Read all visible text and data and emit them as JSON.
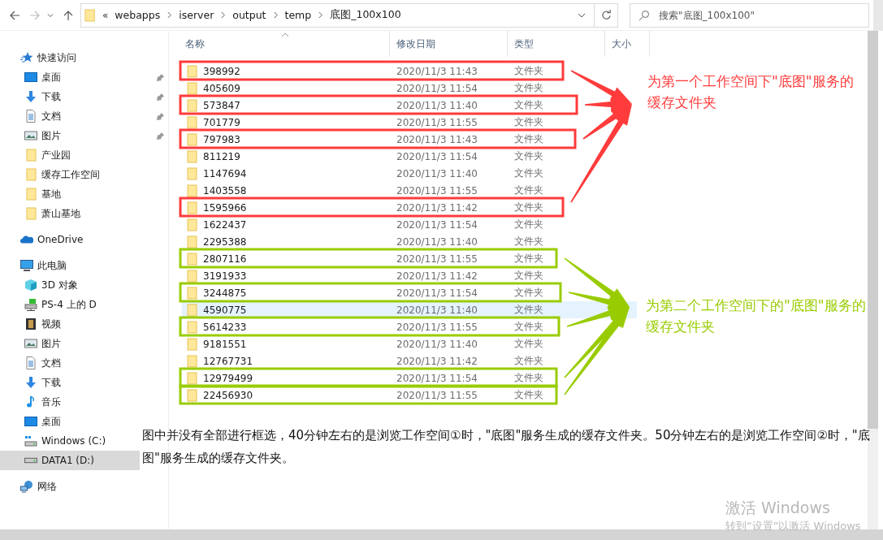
{
  "address_bar": {
    "overflow": "«",
    "segments": [
      "webapps",
      "iserver",
      "output",
      "temp",
      "底图_100x100"
    ]
  },
  "search": {
    "placeholder": "搜索\"底图_100x100\""
  },
  "sidebar": {
    "items": [
      {
        "label": "快速访问",
        "kind": "star",
        "selected": false,
        "children": [
          {
            "label": "桌面",
            "kind": "desktop",
            "pinned": true,
            "selected": false
          },
          {
            "label": "下载",
            "kind": "download",
            "pinned": true,
            "selected": false
          },
          {
            "label": "文档",
            "kind": "document",
            "pinned": true,
            "selected": false
          },
          {
            "label": "图片",
            "kind": "picture",
            "pinned": true,
            "selected": false
          },
          {
            "label": "产业园",
            "kind": "folder",
            "pinned": false,
            "selected": false
          },
          {
            "label": "缓存工作空间",
            "kind": "folder",
            "pinned": false,
            "selected": false
          },
          {
            "label": "基地",
            "kind": "folder",
            "pinned": false,
            "selected": false
          },
          {
            "label": "萧山基地",
            "kind": "folder",
            "pinned": false,
            "selected": false
          }
        ]
      },
      {
        "label": "OneDrive",
        "kind": "cloud",
        "selected": false
      },
      {
        "label": "此电脑",
        "kind": "computer",
        "selected": false,
        "children": [
          {
            "label": "3D 对象",
            "kind": "cube",
            "selected": false
          },
          {
            "label": "PS-4 上的 D",
            "kind": "netdrive",
            "selected": false
          },
          {
            "label": "视频",
            "kind": "video",
            "selected": false
          },
          {
            "label": "图片",
            "kind": "picture",
            "selected": false
          },
          {
            "label": "文档",
            "kind": "document",
            "selected": false
          },
          {
            "label": "下载",
            "kind": "download",
            "selected": false
          },
          {
            "label": "音乐",
            "kind": "music",
            "selected": false
          },
          {
            "label": "桌面",
            "kind": "desktop",
            "selected": false
          },
          {
            "label": "Windows (C:)",
            "kind": "windrive",
            "selected": false
          },
          {
            "label": "DATA1 (D:)",
            "kind": "drive",
            "selected": true
          }
        ]
      },
      {
        "label": "网络",
        "kind": "network",
        "selected": false
      }
    ]
  },
  "file_list": {
    "columns": [
      "名称",
      "修改日期",
      "类型",
      "大小"
    ],
    "rows": [
      {
        "name": "398992",
        "modified": "2020/11/3 11:43",
        "type": "文件夹",
        "hovered": false,
        "color": "#ff3b3b"
      },
      {
        "name": "405609",
        "modified": "2020/11/3 11:54",
        "type": "文件夹",
        "hovered": false
      },
      {
        "name": "573847",
        "modified": "2020/11/3 11:40",
        "type": "文件夹",
        "hovered": false,
        "color": "#ff3b3b"
      },
      {
        "name": "701779",
        "modified": "2020/11/3 11:55",
        "type": "文件夹",
        "hovered": false
      },
      {
        "name": "797983",
        "modified": "2020/11/3 11:43",
        "type": "文件夹",
        "hovered": false,
        "color": "#ff3b3b"
      },
      {
        "name": "811219",
        "modified": "2020/11/3 11:54",
        "type": "文件夹",
        "hovered": false
      },
      {
        "name": "1147694",
        "modified": "2020/11/3 11:40",
        "type": "文件夹",
        "hovered": false
      },
      {
        "name": "1403558",
        "modified": "2020/11/3 11:55",
        "type": "文件夹",
        "hovered": false
      },
      {
        "name": "1595966",
        "modified": "2020/11/3 11:42",
        "type": "文件夹",
        "hovered": false,
        "color": "#ff3b3b"
      },
      {
        "name": "1622437",
        "modified": "2020/11/3 11:54",
        "type": "文件夹",
        "hovered": false
      },
      {
        "name": "2295388",
        "modified": "2020/11/3 11:40",
        "type": "文件夹",
        "hovered": false
      },
      {
        "name": "2807116",
        "modified": "2020/11/3 11:55",
        "type": "文件夹",
        "hovered": false,
        "color": "#99cc00"
      },
      {
        "name": "3191933",
        "modified": "2020/11/3 11:42",
        "type": "文件夹",
        "hovered": false
      },
      {
        "name": "3244875",
        "modified": "2020/11/3 11:54",
        "type": "文件夹",
        "hovered": false,
        "color": "#99cc00"
      },
      {
        "name": "4590775",
        "modified": "2020/11/3 11:40",
        "type": "文件夹",
        "hovered": true
      },
      {
        "name": "5614233",
        "modified": "2020/11/3 11:55",
        "type": "文件夹",
        "hovered": false,
        "color": "#99cc00"
      },
      {
        "name": "9181551",
        "modified": "2020/11/3 11:40",
        "type": "文件夹",
        "hovered": false
      },
      {
        "name": "12767731",
        "modified": "2020/11/3 11:42",
        "type": "文件夹",
        "hovered": false
      },
      {
        "name": "12979499",
        "modified": "2020/11/3 11:54",
        "type": "文件夹",
        "hovered": false,
        "color": "#99cc00"
      },
      {
        "name": "22456930",
        "modified": "2020/11/3 11:55",
        "type": "文件夹",
        "hovered": false,
        "color": "#99cc00"
      }
    ]
  },
  "annotations": [
    {
      "text": "为第一个工作空间下\"底图\"服务的缓存文件夹",
      "color": "#ff3b3b"
    },
    {
      "text": "为第二个工作空间下的\"底图\"服务的缓存文件夹",
      "color": "#99cc00"
    }
  ],
  "note": "图中并没有全部进行框选，40分钟左右的是浏览工作空间①时，\"底图\"服务生成的缓存文件夹。50分钟左右的是浏览工作空间②时，\"底图\"服务生成的缓存文件夹。",
  "activation_notice": {
    "title": "激活 Windows",
    "subtitle": "转到“设置”以激活 Windows"
  }
}
